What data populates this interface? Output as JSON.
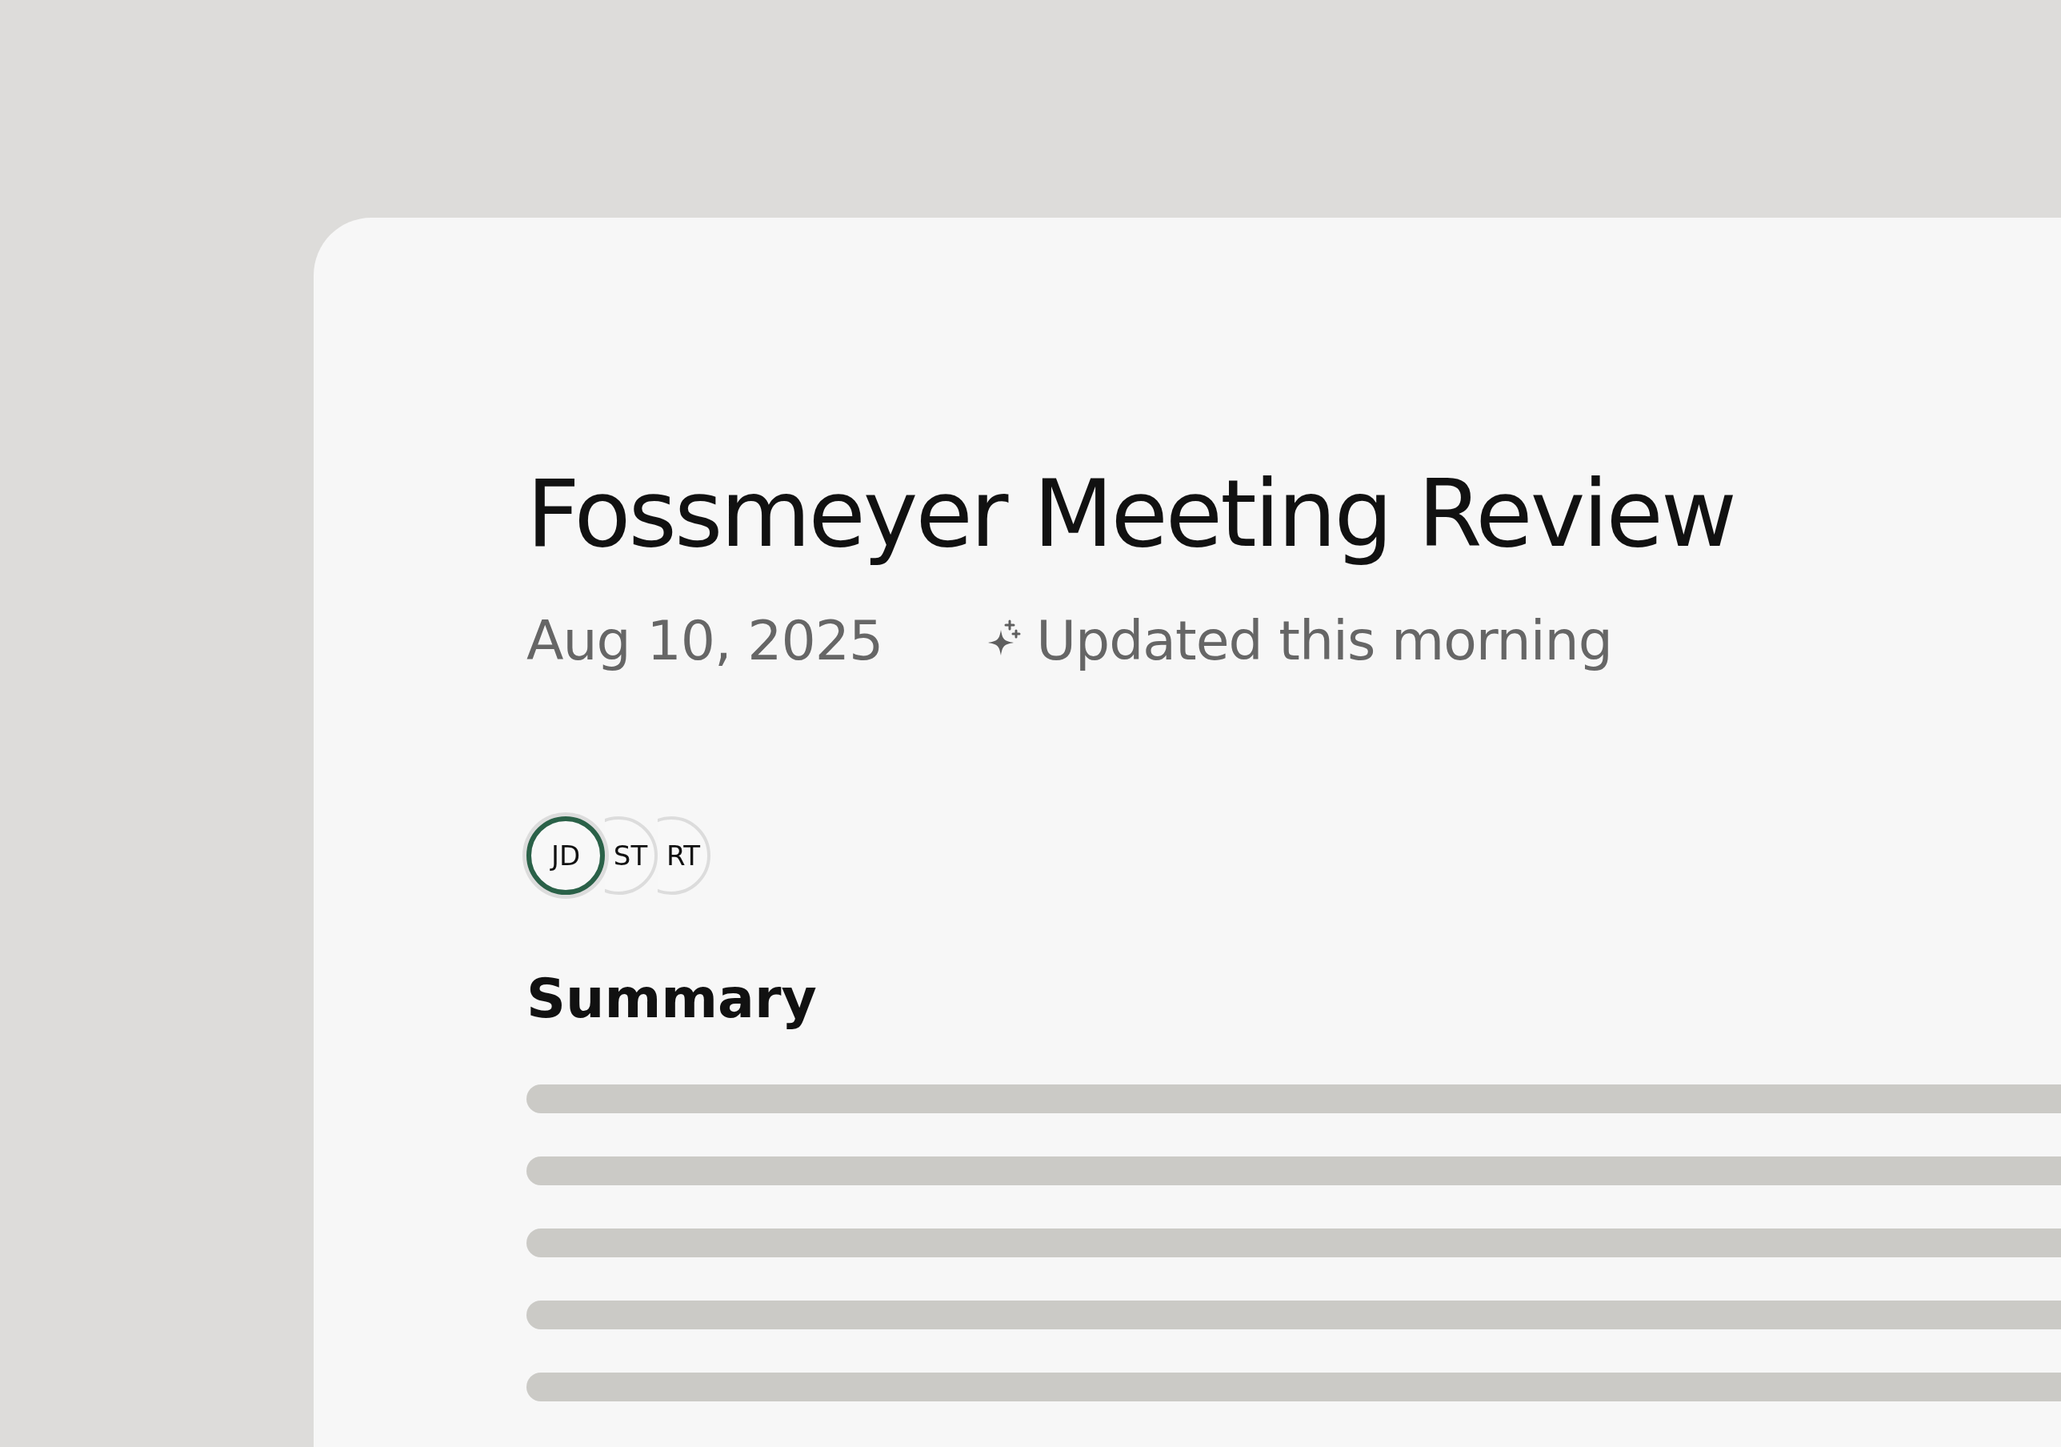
{
  "document": {
    "title": "Fossmeyer Meeting Review",
    "date": "Aug 10, 2025",
    "updated": "Updated this morning"
  },
  "participants": [
    {
      "initials": "JD",
      "selected": true
    },
    {
      "initials": "ST",
      "selected": false
    },
    {
      "initials": "RT",
      "selected": false
    }
  ],
  "section": {
    "heading": "Summary"
  }
}
